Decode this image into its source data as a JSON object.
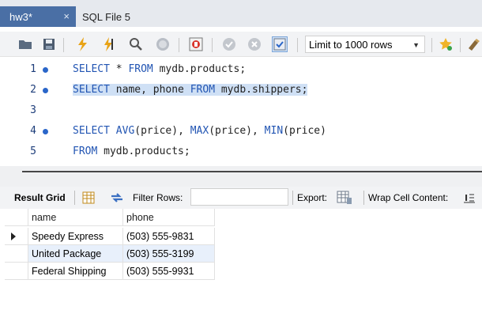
{
  "tabs": [
    {
      "label": "hw3*",
      "active": true,
      "close": "×"
    },
    {
      "label": "SQL File 5",
      "active": false
    }
  ],
  "toolbar": {
    "limit_value": "Limit to 1000 rows",
    "icons": [
      "folder-open-icon",
      "save-icon",
      "execute-lightning-icon",
      "execute-cursor-lightning-icon",
      "explain-magnifier-icon",
      "stop-icon",
      "toggle-error-icon",
      "commit-icon",
      "rollback-icon",
      "autocommit-icon",
      "bookmark-star-icon",
      "beautify-icon"
    ]
  },
  "editor": {
    "lines": [
      {
        "num": "1",
        "dot": true
      },
      {
        "num": "2",
        "dot": true
      },
      {
        "num": "3",
        "dot": false
      },
      {
        "num": "4",
        "dot": true
      },
      {
        "num": "5",
        "dot": false
      }
    ],
    "code": {
      "l1_kw1": "SELECT",
      "l1_t1": " * ",
      "l1_kw2": "FROM",
      "l1_t2": " mydb.products;",
      "l2_kw1": "SELECT",
      "l2_t1": " name, phone ",
      "l2_kw2": "FROM",
      "l2_t2": " mydb.shippers;",
      "l4_kw1": "SELECT",
      "l4_t1": " ",
      "l4_kw2": "AVG",
      "l4_t2": "(price), ",
      "l4_kw3": "MAX",
      "l4_t3": "(price), ",
      "l4_kw4": "MIN",
      "l4_t4": "(price)",
      "l5_kw1": "FROM",
      "l5_t1": " mydb.products;"
    }
  },
  "result_toolbar": {
    "result_grid": "Result Grid",
    "filter_rows": "Filter Rows:",
    "filter_value": "",
    "export": "Export:",
    "wrap_cell": "Wrap Cell Content:"
  },
  "grid": {
    "columns": [
      "name",
      "phone"
    ],
    "rows": [
      {
        "name": "Speedy Express",
        "phone": "(503) 555-9831"
      },
      {
        "name": "United Package",
        "phone": "(503) 555-3199"
      },
      {
        "name": "Federal Shipping",
        "phone": "(503) 555-9931"
      }
    ]
  },
  "colors": {
    "tab_active": "#4a6fa5",
    "keyword": "#2255b3",
    "selection": "#cfe0f5"
  }
}
